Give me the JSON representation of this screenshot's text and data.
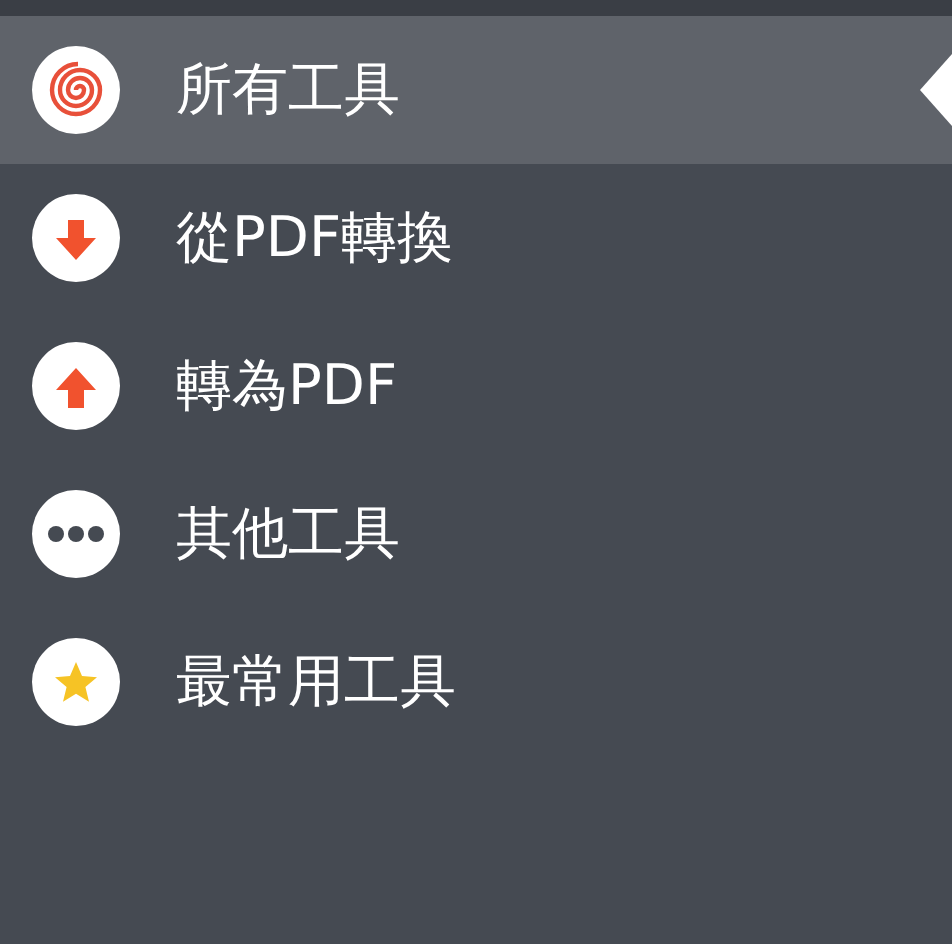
{
  "menu": {
    "items": [
      {
        "label": "所有工具",
        "kind": "spiral",
        "selected": true
      },
      {
        "label": "從PDF轉換",
        "kind": "down",
        "selected": false
      },
      {
        "label": "轉為PDF",
        "kind": "up",
        "selected": false
      },
      {
        "label": "其他工具",
        "kind": "more",
        "selected": false
      },
      {
        "label": "最常用工具",
        "kind": "star",
        "selected": false
      }
    ]
  }
}
